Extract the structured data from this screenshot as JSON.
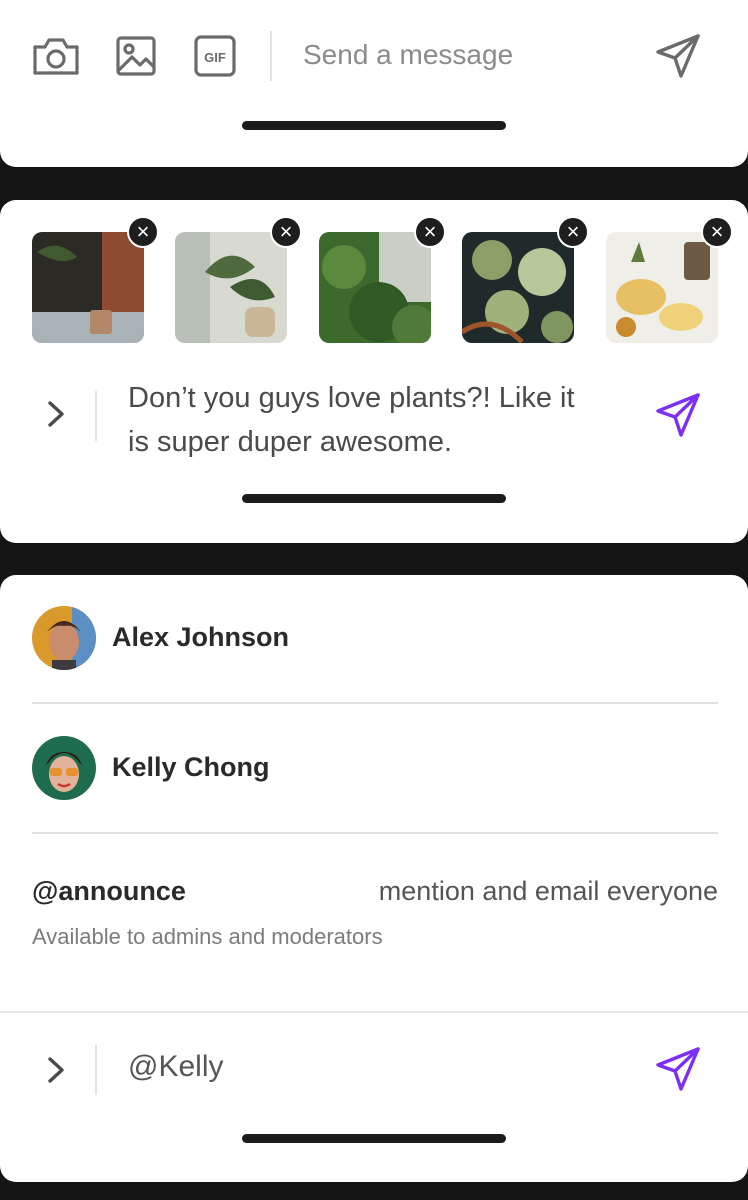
{
  "composer_empty": {
    "icons": [
      "camera-icon",
      "image-icon",
      "gif-icon",
      "send-icon"
    ],
    "gif_label": "GIF",
    "placeholder": "Send a message",
    "send_color": "#6b6b6b"
  },
  "composer_attachments": {
    "thumbnails": [
      {
        "name": "plant-photo-1",
        "colors": [
          "#2c2a25",
          "#6f4a34",
          "#b3886a"
        ]
      },
      {
        "name": "plant-photo-2",
        "colors": [
          "#d8d9d1",
          "#4f6a3d",
          "#c9b797"
        ]
      },
      {
        "name": "plant-photo-3",
        "colors": [
          "#4f7a3a",
          "#2f5a25",
          "#c9cfc7"
        ]
      },
      {
        "name": "plant-photo-4",
        "colors": [
          "#1f2a2b",
          "#8aa066",
          "#b6c79a"
        ]
      },
      {
        "name": "plant-photo-5",
        "colors": [
          "#f0eee9",
          "#e6c063",
          "#c98b2d"
        ]
      }
    ],
    "close_glyph": "×",
    "message_line1": "Don’t you guys love plants?! Like it",
    "message_line2": "is super duper awesome.",
    "send_color": "#7b2ff7"
  },
  "mention_panel": {
    "users": [
      {
        "name": "Alex Johnson",
        "avatar": "avatar-alex"
      },
      {
        "name": "Kelly Chong",
        "avatar": "avatar-kelly"
      }
    ],
    "announce": {
      "handle": "@announce",
      "description": "mention and email everyone",
      "note": "Available to admins and moderators"
    },
    "input_value": "@Kelly",
    "send_color": "#7b2ff7"
  }
}
